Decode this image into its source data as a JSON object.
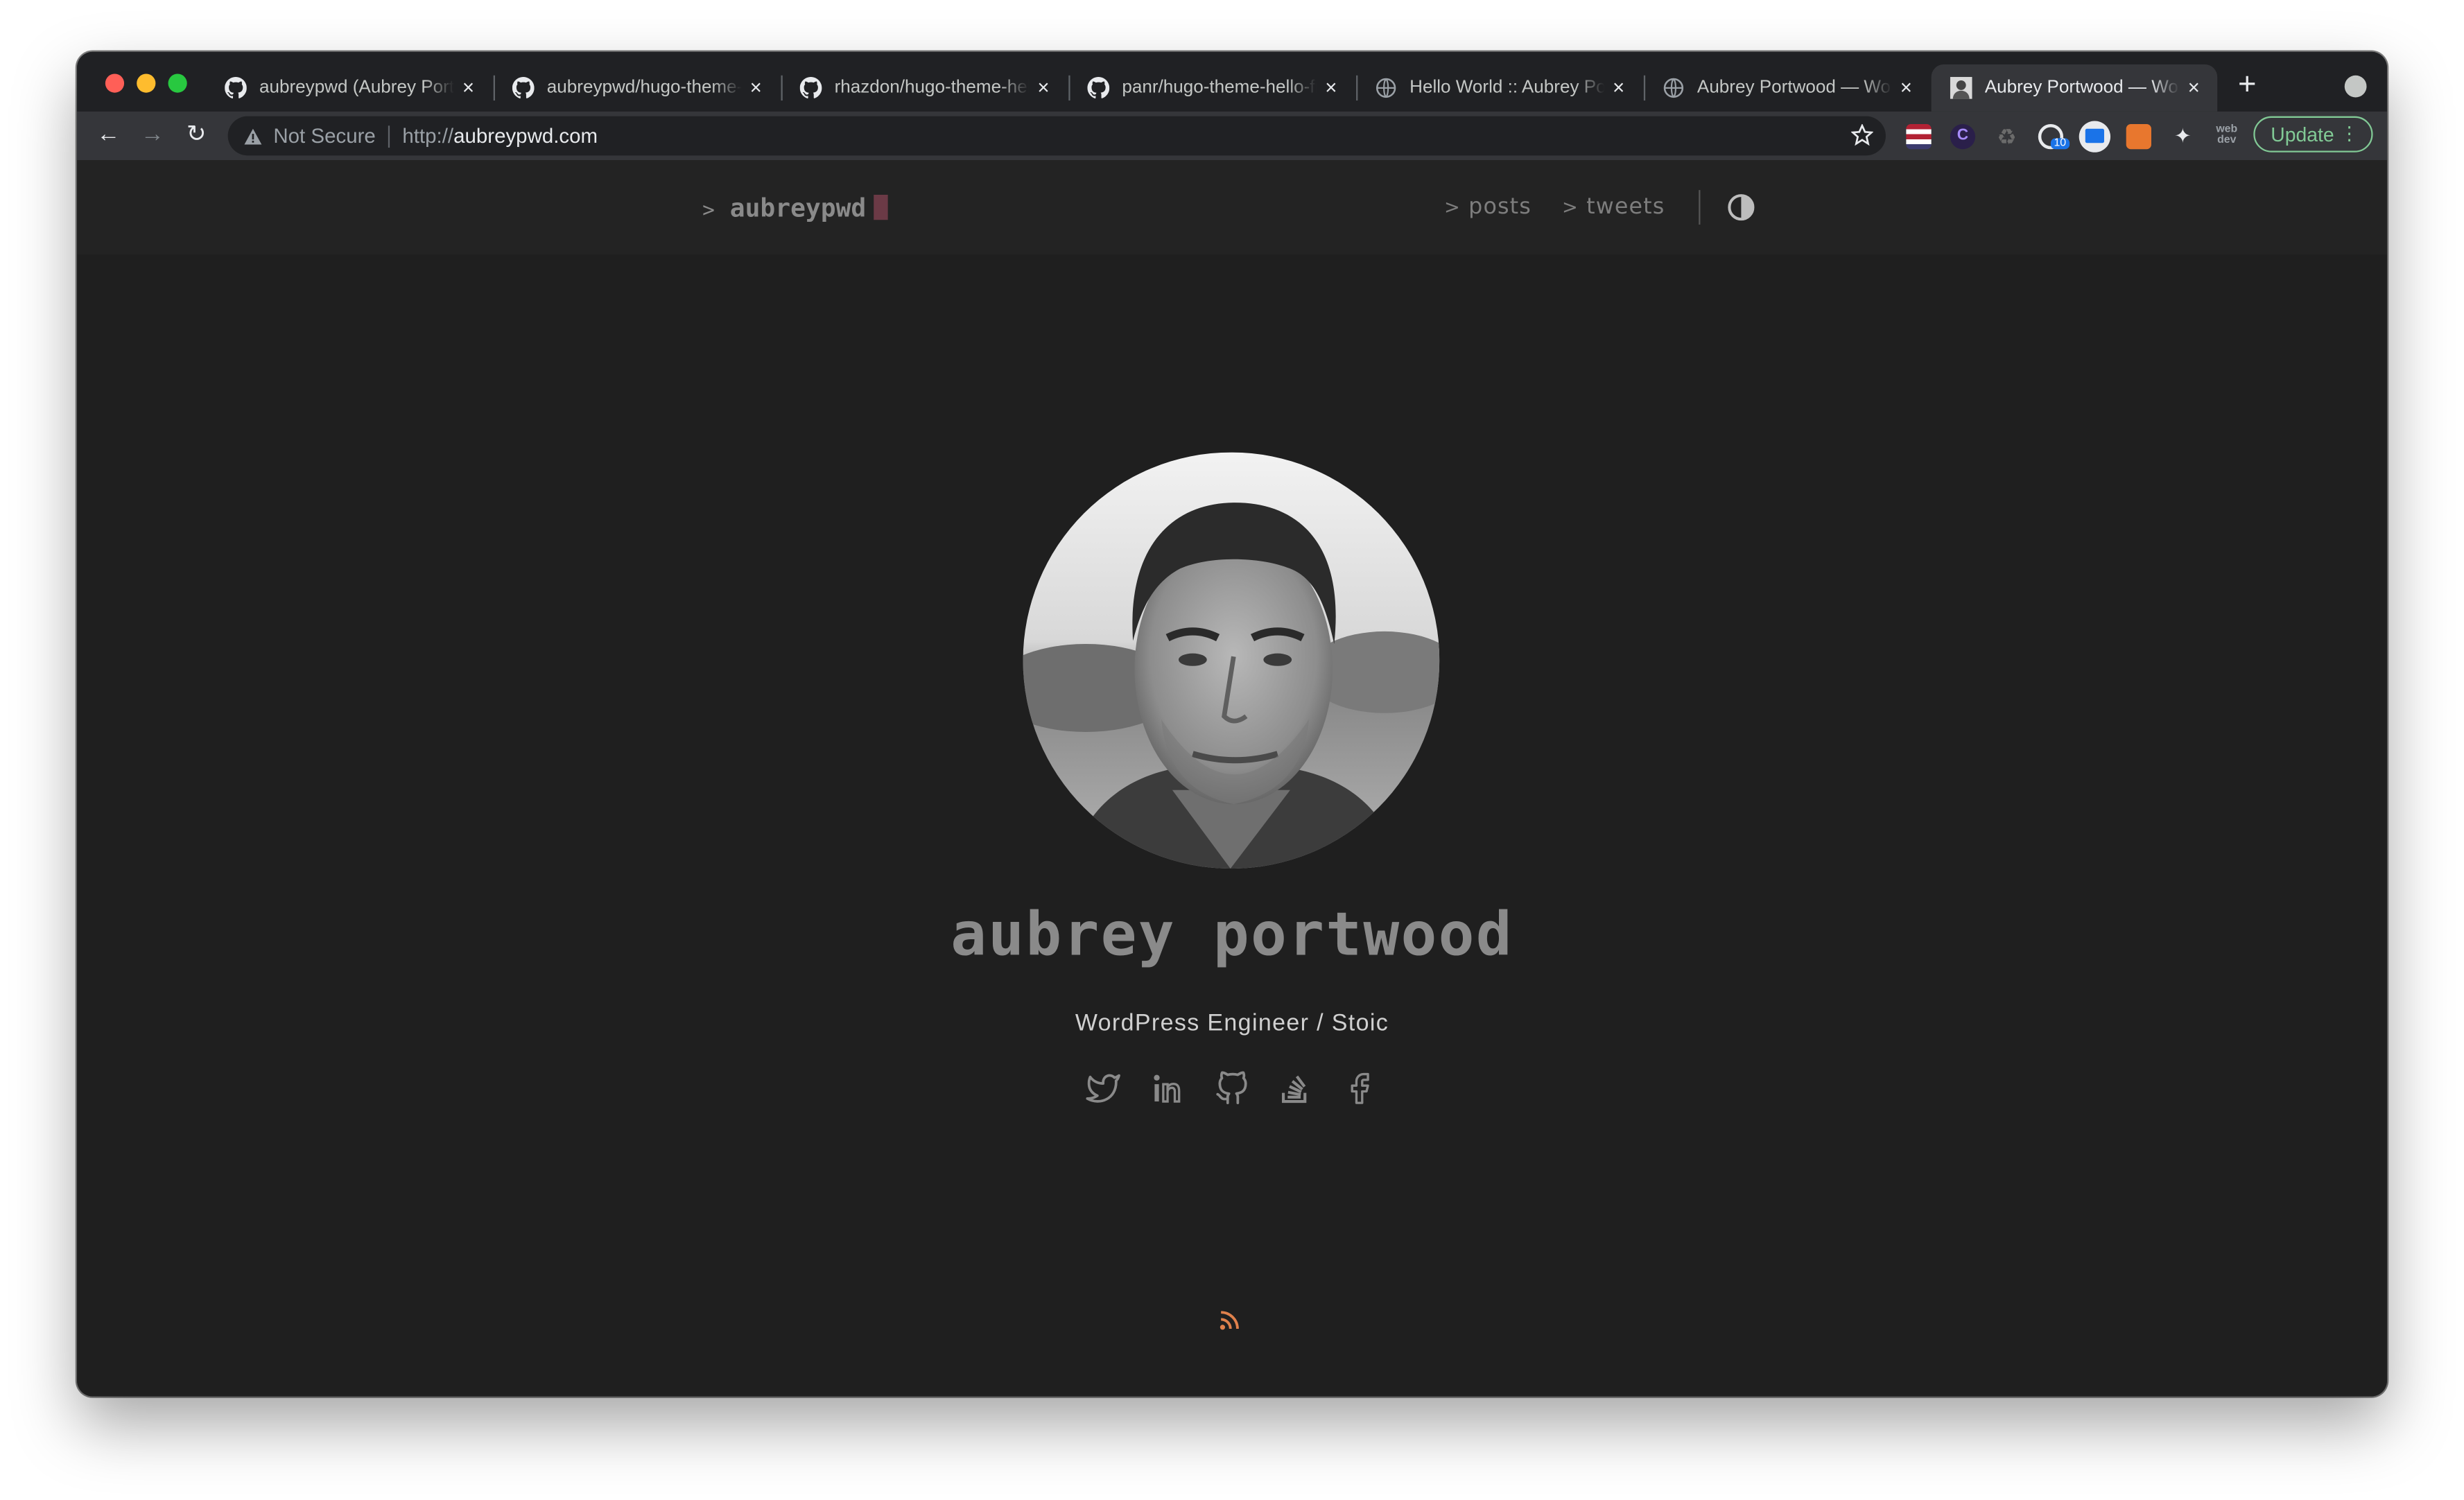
{
  "browser": {
    "tabs": [
      {
        "title": "aubreypwd (Aubrey Portwood)",
        "icon": "github-icon"
      },
      {
        "title": "aubreypwd/hugo-theme-hello-friend-ng",
        "icon": "github-icon"
      },
      {
        "title": "rhazdon/hugo-theme-hello-friend-ng",
        "icon": "github-icon"
      },
      {
        "title": "panr/hugo-theme-hello-friend",
        "icon": "github-icon"
      },
      {
        "title": "Hello World :: Aubrey Portwood",
        "icon": "globe-icon"
      },
      {
        "title": "Aubrey Portwood — WordPress Engineer",
        "icon": "globe-icon"
      },
      {
        "title": "Aubrey Portwood — WordPress Engineer",
        "icon": "site-avatar-icon",
        "active": true
      }
    ],
    "new_tab": "+",
    "address": {
      "security_label": "Not Secure",
      "scheme": "http://",
      "host": "aubreypwd.com"
    },
    "extensions": [
      {
        "name": "flag-icon"
      },
      {
        "name": "c-extension-icon"
      },
      {
        "name": "recycle-icon"
      },
      {
        "name": "badge-extension-icon",
        "badge": "10"
      },
      {
        "name": "screen-extension-icon"
      },
      {
        "name": "rss-extension-icon"
      },
      {
        "name": "puzzle-icon"
      },
      {
        "name": "web-dev-icon",
        "text": "web dev"
      }
    ],
    "update_label": "Update"
  },
  "site": {
    "logo": "aubreypwd",
    "logo_prompt": ">",
    "menu": [
      {
        "prompt": ">",
        "label": "posts"
      },
      {
        "prompt": ">",
        "label": "tweets"
      }
    ],
    "name": "aubrey portwood",
    "tagline": "WordPress Engineer / Stoic",
    "social": [
      "twitter-icon",
      "linkedin-icon",
      "github-icon",
      "stackoverflow-icon",
      "facebook-icon"
    ],
    "colors": {
      "background": "#1f1f1f",
      "header": "#232323",
      "accent": "#6b3a46",
      "rss": "#e0814c",
      "muted_text": "#8a8a8a"
    }
  }
}
